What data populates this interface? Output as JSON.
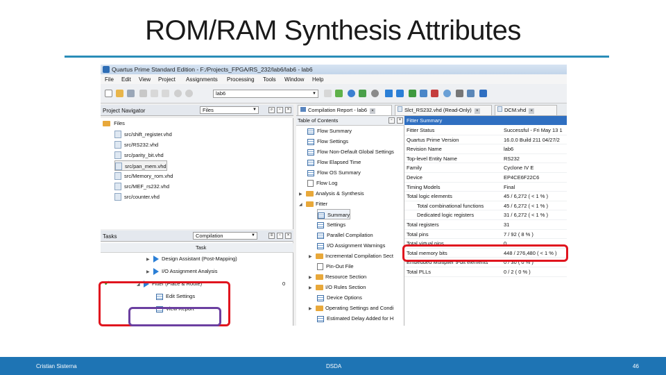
{
  "slide": {
    "title": "ROM/RAM Synthesis Attributes",
    "footer_left": "Cristian Sisterna",
    "footer_center": "DSDA",
    "footer_right": "46"
  },
  "window": {
    "title": "Quartus Prime Standard Edition - F:/Projects_FPGA/RS_232/lab6/lab6 - lab6"
  },
  "menu": [
    "File",
    "Edit",
    "View",
    "Project",
    "Assignments",
    "Processing",
    "Tools",
    "Window",
    "Help"
  ],
  "toolbar": {
    "revision": "lab6"
  },
  "project_navigator": {
    "label": "Project Navigator",
    "view_select": "Files",
    "root": "Files",
    "files": [
      "src/shift_register.vhd",
      "src/RS232.vhd",
      "src/parity_bit.vhd",
      "src/pan_mem.vhd",
      "src/Memory_rom.vhd",
      "src/MEF_rs232.vhd",
      "src/counter.vhd"
    ]
  },
  "tasks": {
    "label": "Tasks",
    "flow_select": "Compilation",
    "column_task": "Task",
    "items": [
      {
        "label": "Design Assistant (Post-Mapping)",
        "status": "",
        "time": ""
      },
      {
        "label": "I/O Assignment Analysis",
        "status": "",
        "time": ""
      },
      {
        "label": "Fitter (Place & Route)",
        "status": "done",
        "time": "0"
      },
      {
        "label": "Edit Settings",
        "status": "",
        "time": ""
      },
      {
        "label": "View Report",
        "status": "",
        "time": ""
      }
    ]
  },
  "tabs": [
    {
      "label": "Compilation Report - lab6"
    },
    {
      "label": "Slct_RS232.vhd (Read-Only)"
    },
    {
      "label": "DCM.vhd"
    }
  ],
  "toc": {
    "header": "Table of Contents",
    "items": [
      "Flow Summary",
      "Flow Settings",
      "Flow Non-Default Global Settings",
      "Flow Elapsed Time",
      "Flow OS Summary",
      "Flow Log",
      "Analysis & Synthesis",
      "Fitter",
      "Summary",
      "Settings",
      "Parallel Compilation",
      "I/O Assignment Warnings",
      "Incremental Compilation Sect",
      "Pin-Out File",
      "Resource Section",
      "I/O Rules Section",
      "Device Options",
      "Operating Settings and Condi",
      "Estimated Delay Added for H"
    ]
  },
  "fitter_summary": {
    "header": "Fitter Summary",
    "rows": [
      {
        "key": "Fitter Status",
        "value": "Successful - Fri May 13 1"
      },
      {
        "key": "Quartus Prime Version",
        "value": "16.0.0 Build 211 04/27/2"
      },
      {
        "key": "Revision Name",
        "value": "lab6"
      },
      {
        "key": "Top-level Entity Name",
        "value": "RS232"
      },
      {
        "key": "Family",
        "value": "Cyclone IV E"
      },
      {
        "key": "Device",
        "value": "EP4CE6F22C6"
      },
      {
        "key": "Timing Models",
        "value": "Final"
      },
      {
        "key": "Total logic elements",
        "value": "45 / 6,272 ( < 1 % )"
      },
      {
        "key": "Total combinational functions",
        "value": "45 / 6,272 ( < 1 % )"
      },
      {
        "key": "Dedicated logic registers",
        "value": "31 / 6,272 ( < 1 % )"
      },
      {
        "key": "Total registers",
        "value": "31"
      },
      {
        "key": "Total pins",
        "value": "7 / 92 ( 8 % )"
      },
      {
        "key": "Total virtual pins",
        "value": "0"
      },
      {
        "key": "Total memory bits",
        "value": "448 / 276,480 ( < 1 % )"
      },
      {
        "key": "Embedded Multiplier 9-bit elements",
        "value": "0 / 30 ( 0 % )"
      },
      {
        "key": "Total PLLs",
        "value": "0 / 2 ( 0 % )"
      }
    ]
  },
  "colors": {
    "title_rule": "#2a8db8",
    "footer_bar": "#1e74b4",
    "highlight_red": "#e0141e",
    "highlight_purple": "#6b3fa0",
    "summary_header": "#2f6fc1"
  }
}
